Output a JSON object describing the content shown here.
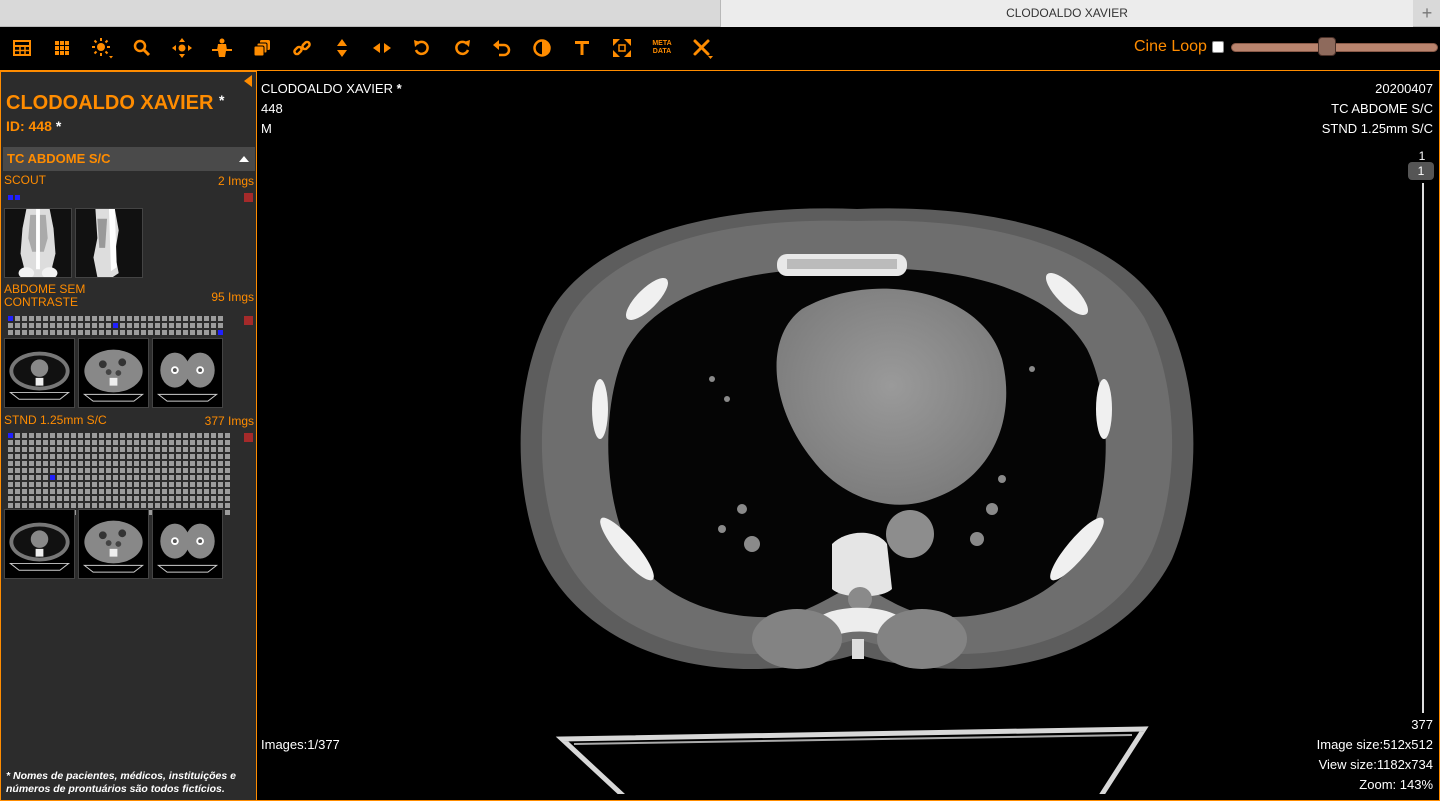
{
  "tab": {
    "title": "CLODOALDO XAVIER",
    "add": "+"
  },
  "toolbar": {
    "tools": [
      {
        "name": "layout-icon"
      },
      {
        "name": "grid-icon"
      },
      {
        "name": "brightness-icon"
      },
      {
        "name": "zoom-icon"
      },
      {
        "name": "pan-icon"
      },
      {
        "name": "scout-icon"
      },
      {
        "name": "stack-icon"
      },
      {
        "name": "measure-icon"
      },
      {
        "name": "flip-vertical-icon"
      },
      {
        "name": "flip-horizontal-icon"
      },
      {
        "name": "rotate-left-icon"
      },
      {
        "name": "rotate-right-icon"
      },
      {
        "name": "undo-icon"
      },
      {
        "name": "invert-icon"
      },
      {
        "name": "text-icon"
      },
      {
        "name": "fullscreen-icon"
      },
      {
        "name": "metadata-icon",
        "label": "META DATA"
      },
      {
        "name": "tools-icon"
      }
    ],
    "cine_label": "Cine Loop",
    "cine_enabled": false,
    "cine_speed": 0.46
  },
  "colors": {
    "accent": "#ff8c00",
    "panel": "#2c2c2c",
    "marker": "#a52a2a",
    "active_dot": "#2020ff"
  },
  "patient": {
    "name": "CLODOALDO XAVIER",
    "id_label": "ID: 448",
    "star": "*"
  },
  "study": {
    "title": "TC ABDOME S/C"
  },
  "series": [
    {
      "name": "SCOUT",
      "count": "2 Imgs"
    },
    {
      "name": "ABDOME SEM CONTRASTE",
      "count": "95 Imgs"
    },
    {
      "name": "STND 1.25mm S/C",
      "count": "377 Imgs"
    }
  ],
  "disclaimer": "* Nomes de pacientes, médicos, instituições e números de prontuários são todos fictícios.",
  "viewer": {
    "top_left": {
      "name": "CLODOALDO XAVIER",
      "star": "*",
      "id": "448",
      "sex": "M"
    },
    "top_right": {
      "date": "20200407",
      "study": "TC ABDOME S/C",
      "series": "STND 1.25mm S/C"
    },
    "bottom_left": {
      "images": "Images:1/377"
    },
    "bottom_right": {
      "image_size": "Image size:512x512",
      "view_size": "View size:1182x734",
      "zoom": "Zoom: 143%"
    },
    "scroll": {
      "top": "1",
      "current": "1",
      "bottom": "377"
    }
  }
}
